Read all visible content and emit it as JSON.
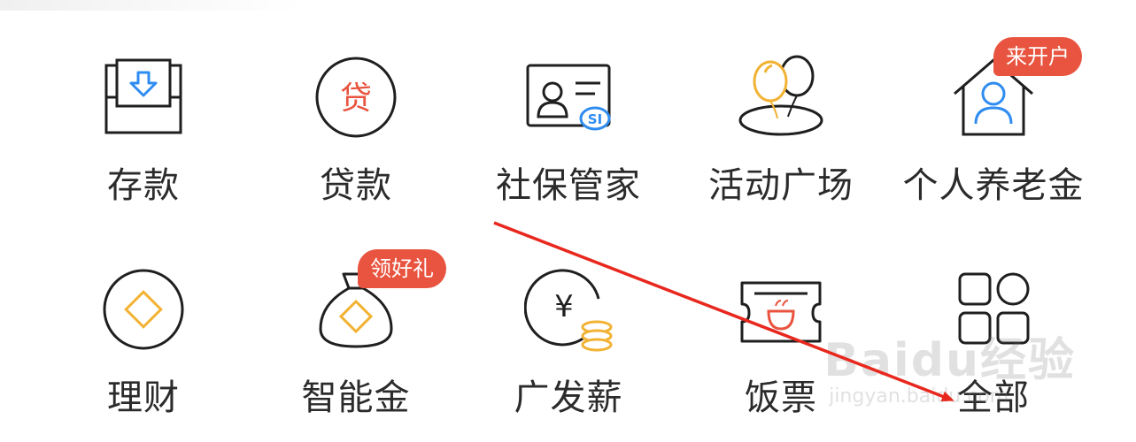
{
  "colors": {
    "accent_red": "#e8543f",
    "accent_yellow": "#f2b233",
    "accent_blue": "#2f8cf0",
    "icon_stroke": "#1f1f1f",
    "label_text": "#2b2b2b",
    "arrow": "#e8281e"
  },
  "grid": {
    "items": [
      {
        "id": "deposit",
        "label": "存款",
        "icon": "deposit-tray-icon"
      },
      {
        "id": "loan",
        "label": "贷款",
        "icon": "loan-coin-icon"
      },
      {
        "id": "social-security",
        "label": "社保管家",
        "icon": "social-security-card-icon"
      },
      {
        "id": "activity-plaza",
        "label": "活动广场",
        "icon": "balloons-icon"
      },
      {
        "id": "pension",
        "label": "个人养老金",
        "icon": "house-person-icon",
        "badge": "来开户"
      },
      {
        "id": "wealth",
        "label": "理财",
        "icon": "diamond-circle-icon"
      },
      {
        "id": "smart-gold",
        "label": "智能金",
        "icon": "money-bag-icon",
        "badge": "领好礼"
      },
      {
        "id": "payroll",
        "label": "广发薪",
        "icon": "yen-coins-icon"
      },
      {
        "id": "meal-ticket",
        "label": "饭票",
        "icon": "meal-ticket-icon"
      },
      {
        "id": "all",
        "label": "全部",
        "icon": "all-apps-grid-icon"
      }
    ]
  },
  "watermark": {
    "main": "Baidu经验",
    "sub": "jingyan.baidu.com"
  }
}
